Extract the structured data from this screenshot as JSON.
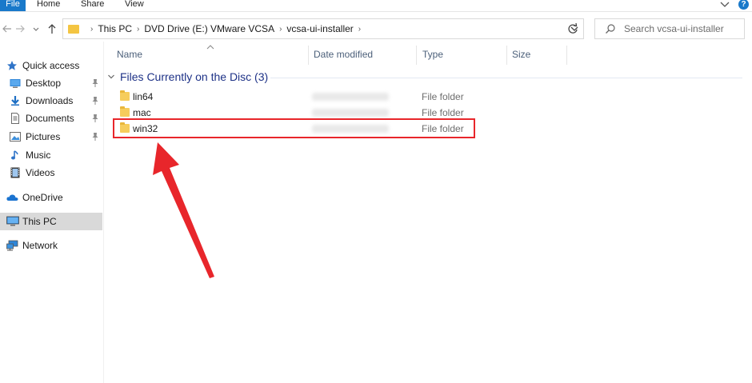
{
  "ribbon": {
    "tabs": [
      {
        "label": "File"
      },
      {
        "label": "Home"
      },
      {
        "label": "Share"
      },
      {
        "label": "View"
      }
    ],
    "help_label": "?"
  },
  "address": {
    "crumbs": [
      "This PC",
      "DVD Drive (E:) VMware VCSA",
      "vcsa-ui-installer"
    ]
  },
  "search": {
    "placeholder": "Search vcsa-ui-installer"
  },
  "nav": {
    "items": [
      {
        "label": "Quick access",
        "icon": "star-icon"
      },
      {
        "label": "Desktop",
        "icon": "desktop-icon",
        "pinned": true
      },
      {
        "label": "Downloads",
        "icon": "download-icon",
        "pinned": true
      },
      {
        "label": "Documents",
        "icon": "documents-icon",
        "pinned": true
      },
      {
        "label": "Pictures",
        "icon": "pictures-icon",
        "pinned": true
      },
      {
        "label": "Music",
        "icon": "music-icon"
      },
      {
        "label": "Videos",
        "icon": "videos-icon"
      },
      {
        "label": "OneDrive",
        "icon": "cloud-icon"
      },
      {
        "label": "This PC",
        "icon": "computer-icon",
        "selected": true
      },
      {
        "label": "Network",
        "icon": "network-icon"
      }
    ]
  },
  "columns": [
    "Name",
    "Date modified",
    "Type",
    "Size"
  ],
  "group": {
    "label": "Files Currently on the Disc (3)"
  },
  "files": [
    {
      "name": "lin64",
      "type": "File folder"
    },
    {
      "name": "mac",
      "type": "File folder"
    },
    {
      "name": "win32",
      "type": "File folder"
    }
  ],
  "colors": {
    "accent": "#1979ca",
    "highlight": "#e8262b",
    "group_text": "#1e3287",
    "folder": "#f6cd5c"
  }
}
